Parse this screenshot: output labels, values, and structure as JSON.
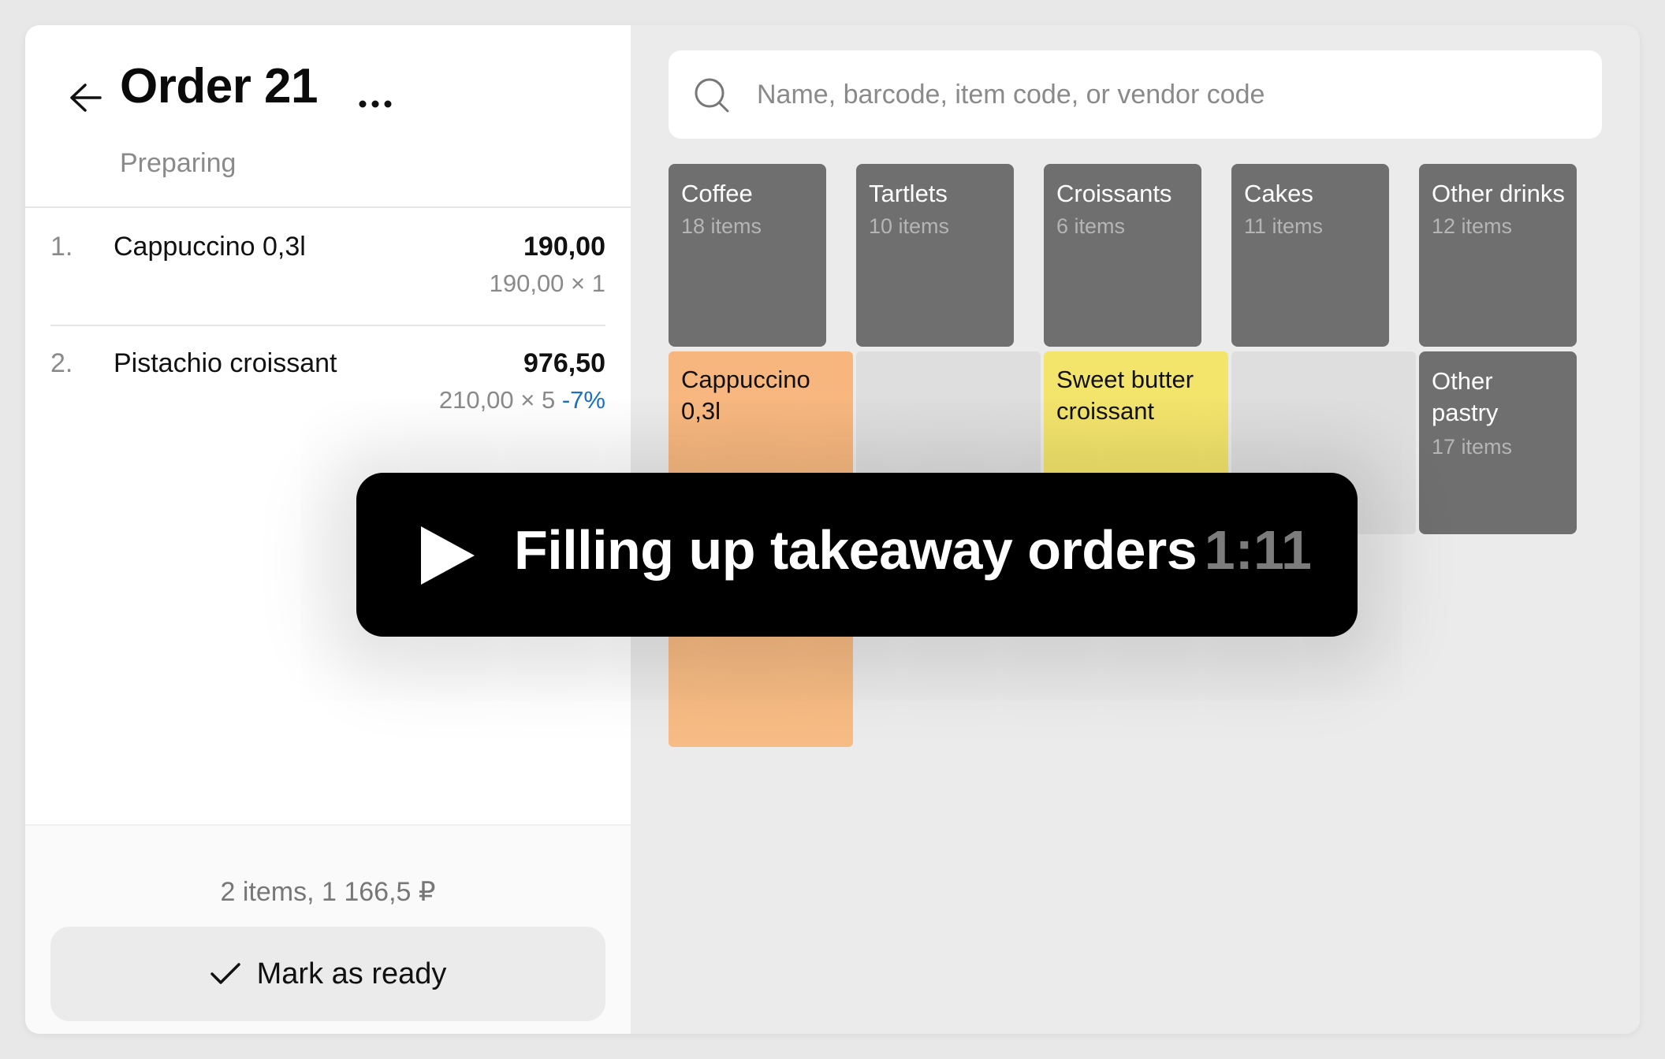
{
  "order": {
    "title": "Order 21",
    "status": "Preparing",
    "items": [
      {
        "num": "1.",
        "name": "Cappuccino 0,3l",
        "total": "190,00",
        "calc": "190,00 × 1",
        "discount": ""
      },
      {
        "num": "2.",
        "name": "Pistachio croissant",
        "total": "976,50",
        "calc": "210,00 × 5",
        "discount": "-7%"
      }
    ],
    "summary": "2 items, 1 166,5 ₽",
    "ready_label": "Mark as ready"
  },
  "search": {
    "placeholder": "Name, barcode, item code, or vendor code"
  },
  "categories": [
    {
      "name": "Coffee",
      "count": "18 items",
      "accent": "#f5b982"
    },
    {
      "name": "Tartlets",
      "count": "10 items",
      "accent": "#f4a6a0"
    },
    {
      "name": "Croissants",
      "count": "6 items",
      "accent": "#f2e36a"
    },
    {
      "name": "Cakes",
      "count": "11 items",
      "accent": "#9ccaf5"
    },
    {
      "name": "Other drinks",
      "count": "12 items",
      "accent": "#bdbdbd"
    },
    {
      "name": "Other pastry",
      "count": "17 items",
      "accent": "#bdbdbd"
    }
  ],
  "products": [
    {
      "name": "Cappuccino 0,3l",
      "color": "#f7bc85"
    },
    {
      "name": "Sweet butter croissant",
      "color": "#f3e46c"
    }
  ],
  "video": {
    "title": "Filling up takeaway orders",
    "duration": "1:11"
  }
}
